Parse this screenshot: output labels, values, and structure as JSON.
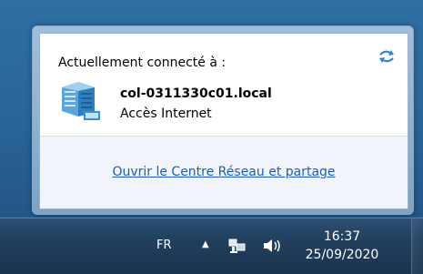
{
  "popup": {
    "header": "Actuellement connecté à :",
    "network_name": "col-0311330c01.local",
    "network_access": "Accès Internet",
    "link_label": "Ouvrir le Centre Réseau et partage",
    "refresh_icon": "refresh-icon",
    "network_icon": "domain-network-icon"
  },
  "taskbar": {
    "language": "FR",
    "tray_arrow": "▲",
    "network_icon": "network-tray-icon",
    "volume_icon": "volume-tray-icon",
    "time": "16:37",
    "date": "25/09/2020"
  }
}
